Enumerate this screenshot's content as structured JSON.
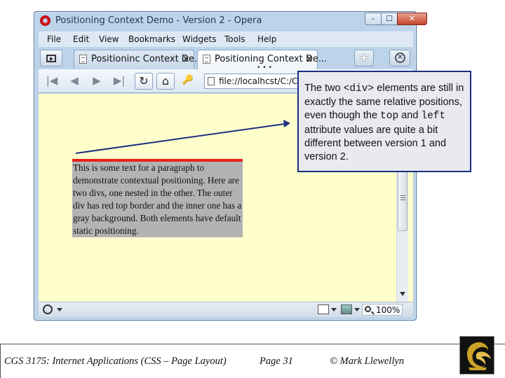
{
  "browser": {
    "window_title": "Positioning Context Demo - Version 2 - Opera",
    "window_buttons": {
      "minimize": "–",
      "maximize": "☐",
      "close": "✕"
    },
    "menu": [
      "File",
      "Edit",
      "View",
      "Bookmarks",
      "Widgets",
      "Tools",
      "Help"
    ],
    "tabs": [
      {
        "label": "Positioninc Context De...",
        "close": "x",
        "active": false
      },
      {
        "label": "Positioning Context De...",
        "close": "x",
        "active": true
      }
    ],
    "tab_overflow": "• • •",
    "new_tab": "+",
    "nav": {
      "first": "|◀",
      "back": "◀",
      "forward": "▶",
      "last": "▶|",
      "reload": "↻",
      "home": "⌂",
      "key": "🔑"
    },
    "address": {
      "value": "file://localhcst/C:/C"
    },
    "status": {
      "zoom": "100%"
    }
  },
  "page": {
    "paragraph": "This is some text for a paragraph to demonstrate contextual positioning. Here are two divs, one nested in the other. The outer div has red top border and the inner one has a gray background. Both elements have default static positioning."
  },
  "callout": {
    "part1": "The two ",
    "code1": "<div>",
    "part2": " elements are still in exactly the same relative positions, even though the ",
    "code2": "top",
    "part3": " and ",
    "code3": "left",
    "part4": " attribute values are quite a bit different between version 1 and version 2."
  },
  "footer": {
    "course": "CGS 3175: Internet Applications (CSS – Page Layout)",
    "page": "Page 31",
    "author": "© Mark Llewellyn"
  },
  "colors": {
    "page_background": "#ffffcc",
    "outer_border": "#e8221b",
    "inner_background": "#b3b3b3",
    "callout_border": "#1c2f80",
    "pointer": "#1c2f80"
  }
}
